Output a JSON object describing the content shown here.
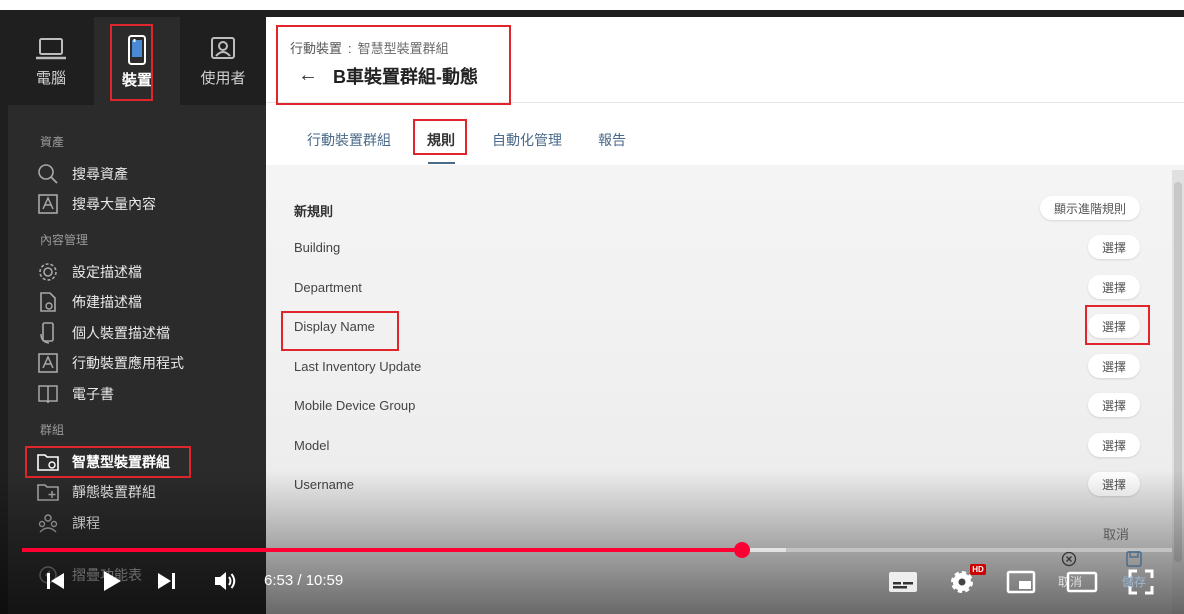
{
  "sidebar": {
    "tabs": [
      {
        "label": "電腦",
        "icon": "laptop-icon"
      },
      {
        "label": "裝置",
        "icon": "mobile-device-icon"
      },
      {
        "label": "使用者",
        "icon": "users-icon"
      }
    ],
    "sections": {
      "assets": "資產",
      "content_mgmt": "內容管理",
      "groups": "群組"
    },
    "items": {
      "search_assets": "搜尋資產",
      "search_bulk": "搜尋大量內容",
      "config_profiles": "設定描述檔",
      "build_profiles": "佈建描述檔",
      "personal_profiles": "個人裝置描述檔",
      "mobile_apps": "行動裝置應用程式",
      "ebooks": "電子書",
      "smart_groups": "智慧型裝置群組",
      "static_groups": "靜態裝置群組",
      "classes": "課程",
      "collapse_menu": "摺疊功能表"
    }
  },
  "header": {
    "breadcrumb_root": "行動裝置",
    "breadcrumb_sep": ":",
    "breadcrumb_link": "智慧型裝置群組",
    "back": "←",
    "title": "B車裝置群組-動態"
  },
  "tabs": {
    "groups": "行動裝置群組",
    "rules": "規則",
    "automation": "自動化管理",
    "reports": "報告"
  },
  "rules": {
    "new_rule": "新規則",
    "show_advanced": "顯示進階規則",
    "choose": "選擇",
    "criteria": [
      "Building",
      "Department",
      "Display Name",
      "Last Inventory Update",
      "Mobile Device Group",
      "Model",
      "Username"
    ],
    "cancel": "取消"
  },
  "player": {
    "time": "6:53 / 10:59",
    "hd": "HD",
    "cancel_hint": "取消",
    "save_hint": "儲存",
    "progress_fraction": 0.626
  }
}
